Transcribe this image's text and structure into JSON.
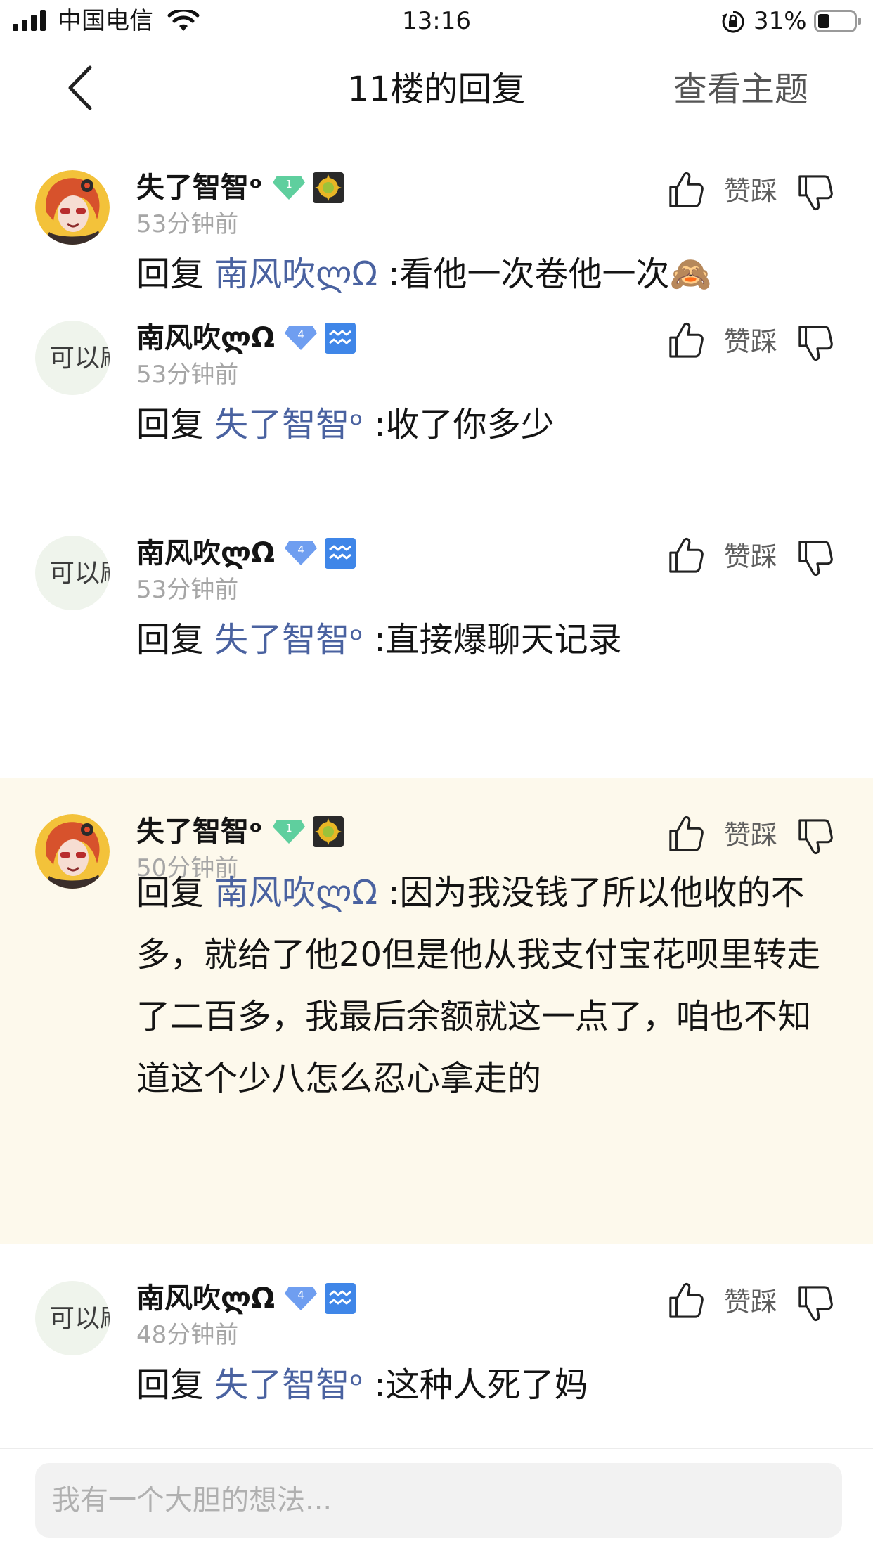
{
  "status_bar": {
    "carrier": "中国电信",
    "time": "13:16",
    "battery_percent": "31%",
    "battery_level": 0.31
  },
  "header": {
    "title": "11楼的回复",
    "view_topic": "查看主题"
  },
  "vote_label": "赞踩",
  "reply_prefix": "回复",
  "comments": [
    {
      "username": "失了智智ᵒ",
      "level": "1",
      "level_color": "#5fcf9e",
      "time": "53分钟前",
      "mention": "南风吹ლΩ",
      "text": ":看他一次卷他一次🙈",
      "avatar_text": "",
      "highlighted": false
    },
    {
      "username": "南风吹ლΩ",
      "level": "4",
      "level_color": "#6f9ef0",
      "time": "53分钟前",
      "mention": "失了智智ᵒ",
      "text": ":收了你多少",
      "avatar_text": "可以刷",
      "highlighted": false
    },
    {
      "username": "南风吹ლΩ",
      "level": "4",
      "level_color": "#6f9ef0",
      "time": "53分钟前",
      "mention": "失了智智ᵒ",
      "text": ":直接爆聊天记录",
      "avatar_text": "可以刷",
      "highlighted": false
    },
    {
      "username": "失了智智ᵒ",
      "level": "1",
      "level_color": "#5fcf9e",
      "time": "50分钟前",
      "mention": "南风吹ლΩ",
      "text": ":因为我没钱了所以他收的不多，就给了他20但是他从我支付宝花呗里转走了二百多，我最后余额就这一点了，咱也不知道这个少八怎么忍心拿走的",
      "avatar_text": "",
      "highlighted": true
    },
    {
      "username": "南风吹ლΩ",
      "level": "4",
      "level_color": "#6f9ef0",
      "time": "48分钟前",
      "mention": "失了智智ᵒ",
      "text": ":这种人死了妈",
      "avatar_text": "可以刷",
      "highlighted": false
    }
  ],
  "input": {
    "placeholder": "我有一个大胆的想法..."
  },
  "icons": {
    "back": "chevron-left-icon",
    "like": "thumbs-up-icon",
    "dislike": "thumbs-down-icon",
    "sun_badge": "sun-badge-icon",
    "aquarius_badge": "aquarius-badge-icon"
  }
}
